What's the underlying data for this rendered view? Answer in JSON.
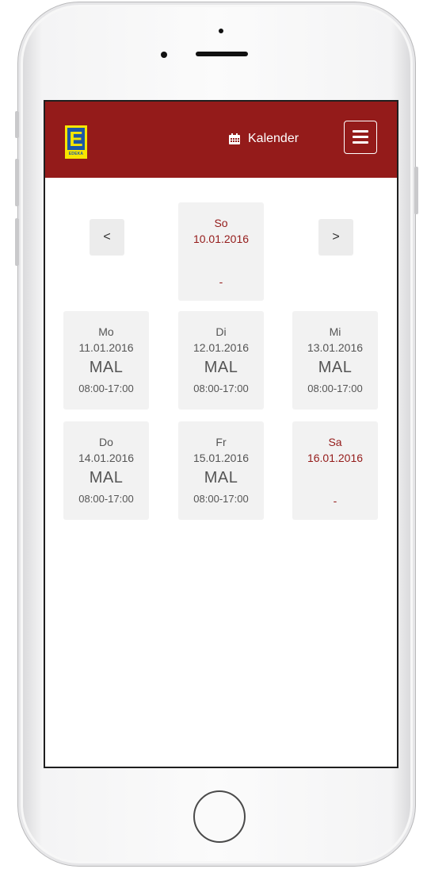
{
  "header": {
    "title": "Kalender",
    "logo_letter": "E",
    "logo_wordmark": "EDEKA",
    "brand_color": "#941b1a"
  },
  "nav": {
    "prev_label": "<",
    "next_label": ">"
  },
  "current_day": {
    "dayname": "So",
    "date": "10.01.2016",
    "entry": "-"
  },
  "week": [
    {
      "dayname": "Mo",
      "date": "11.01.2016",
      "code": "MAL",
      "time": "08:00-17:00"
    },
    {
      "dayname": "Di",
      "date": "12.01.2016",
      "code": "MAL",
      "time": "08:00-17:00"
    },
    {
      "dayname": "Mi",
      "date": "13.01.2016",
      "code": "MAL",
      "time": "08:00-17:00"
    },
    {
      "dayname": "Do",
      "date": "14.01.2016",
      "code": "MAL",
      "time": "08:00-17:00"
    },
    {
      "dayname": "Fr",
      "date": "15.01.2016",
      "code": "MAL",
      "time": "08:00-17:00"
    },
    {
      "dayname": "Sa",
      "date": "16.01.2016",
      "entry": "-"
    }
  ]
}
